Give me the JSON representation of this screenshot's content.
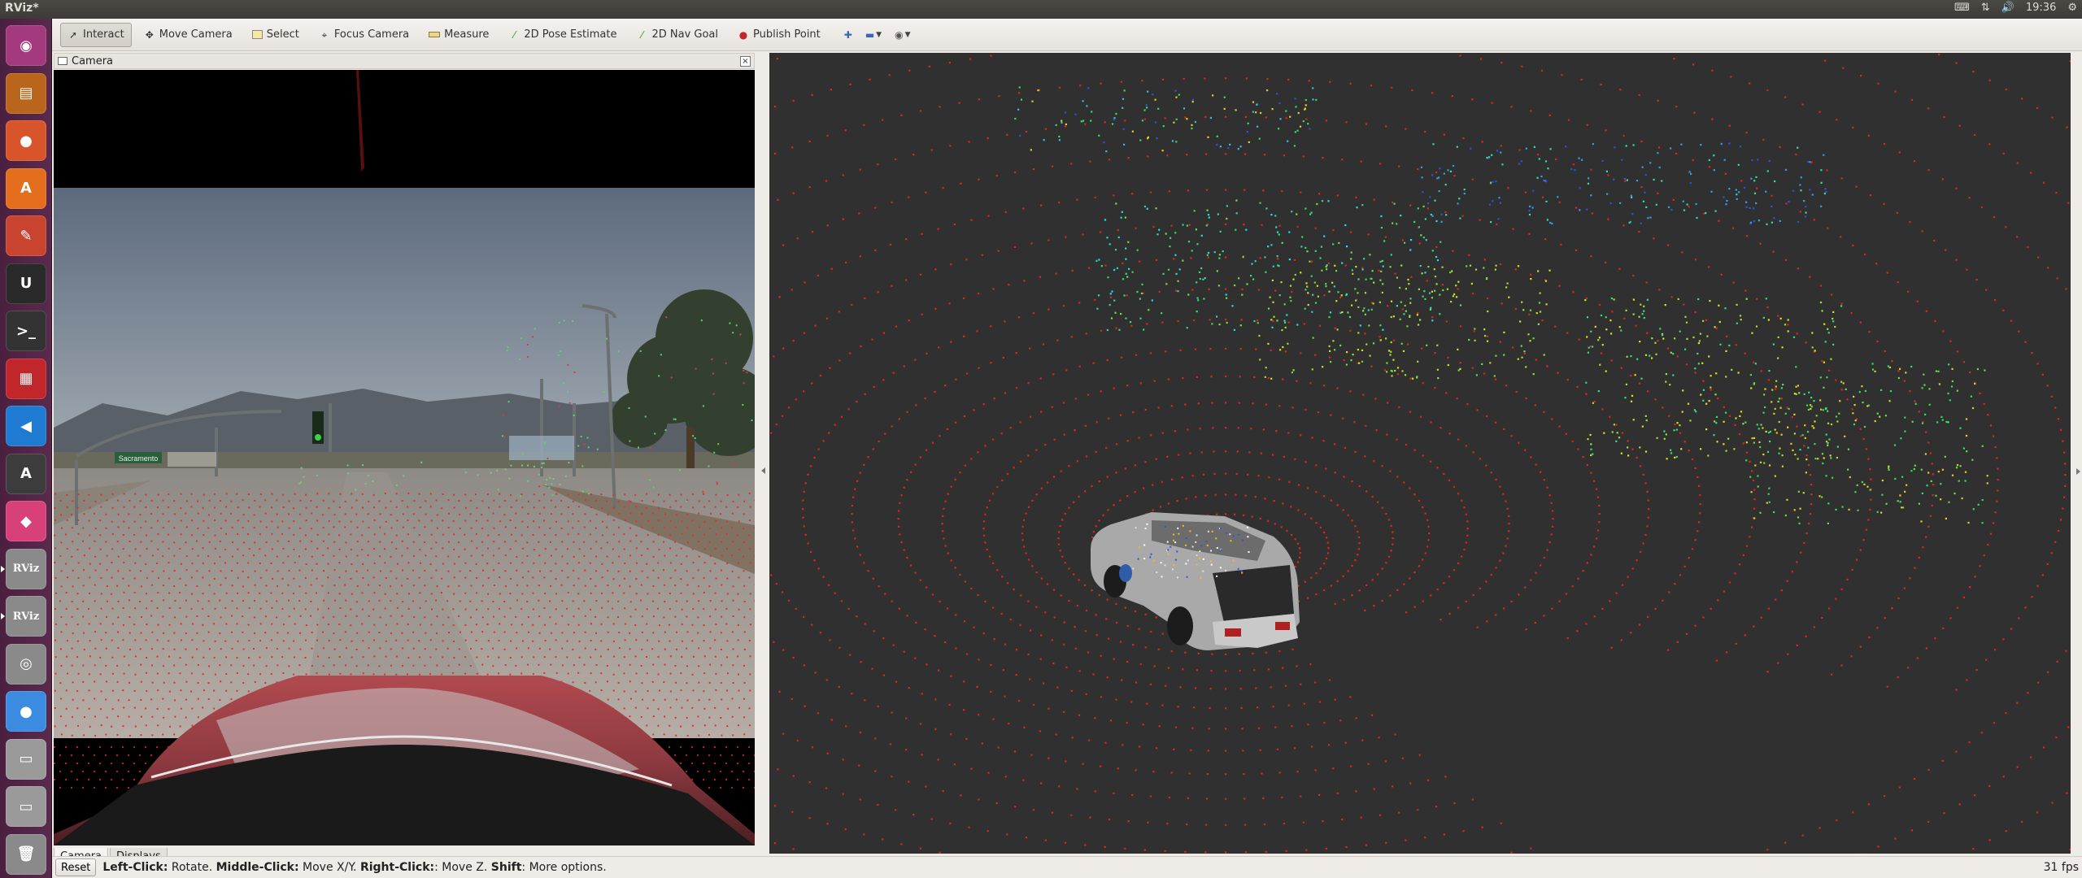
{
  "window_title": "RViz*",
  "tray": {
    "keyboard": "⌨",
    "network": "⇅",
    "volume": "🔊",
    "clock": "19:36",
    "settings": "⚙"
  },
  "launcher": [
    {
      "name": "ubuntu-dash-icon",
      "glyph": "◉",
      "bg": "#a33a7e"
    },
    {
      "name": "files-icon",
      "glyph": "▤",
      "bg": "#b9651b"
    },
    {
      "name": "firefox-icon",
      "glyph": "●",
      "bg": "#d8542a"
    },
    {
      "name": "software-center-icon",
      "glyph": "A",
      "bg": "#e56d1e"
    },
    {
      "name": "system-settings-icon",
      "glyph": "✎",
      "bg": "#c9442e"
    },
    {
      "name": "unreal-engine-icon",
      "glyph": "U",
      "bg": "#2a2a2a"
    },
    {
      "name": "terminal-icon",
      "glyph": ">_",
      "bg": "#333333"
    },
    {
      "name": "app-red-icon",
      "glyph": "▦",
      "bg": "#c0262a"
    },
    {
      "name": "vscode-icon",
      "glyph": "◀",
      "bg": "#1f7bd1"
    },
    {
      "name": "software-updater-icon",
      "glyph": "A",
      "bg": "#3c3c3c"
    },
    {
      "name": "app-pink-icon",
      "glyph": "◆",
      "bg": "#d8407a"
    },
    {
      "name": "rviz-icon-1",
      "glyph": "RViz",
      "bg": "#8a8a8a"
    },
    {
      "name": "rviz-icon-2",
      "glyph": "RViz",
      "bg": "#8a8a8a"
    },
    {
      "name": "camera-app-icon",
      "glyph": "◎",
      "bg": "#8a8a8a"
    },
    {
      "name": "chrome-icon",
      "glyph": "●",
      "bg": "#3b8be0"
    },
    {
      "name": "drive-icon-1",
      "glyph": "▭",
      "bg": "#9a9a9a"
    },
    {
      "name": "drive-icon-2",
      "glyph": "▭",
      "bg": "#9a9a9a"
    },
    {
      "name": "trash-icon",
      "glyph": "🗑",
      "bg": "#8a8a8a"
    }
  ],
  "toolbar": {
    "interact": "Interact",
    "move_camera": "Move Camera",
    "select": "Select",
    "focus_camera": "Focus Camera",
    "measure": "Measure",
    "pose_estimate": "2D Pose Estimate",
    "nav_goal": "2D Nav Goal",
    "publish_point": "Publish Point"
  },
  "camera_panel": {
    "title": "Camera",
    "close": "×"
  },
  "camera_image": {
    "street_sign": "Sacramento"
  },
  "tabs": {
    "camera": "Camera",
    "displays": "Displays"
  },
  "status": {
    "reset": "Reset",
    "left_click": "Left-Click:",
    "left_action": " Rotate. ",
    "middle_click": "Middle-Click:",
    "middle_action": " Move X/Y. ",
    "right_click": "Right-Click:",
    "right_action": ": Move Z. ",
    "shift": "Shift",
    "shift_action": ": More options.",
    "fps": "31 fps"
  },
  "colors": {
    "render_bg": "#303030",
    "lidar_near": "#e02010",
    "lidar_far": "#30e060",
    "accent": "#3a67b8"
  }
}
